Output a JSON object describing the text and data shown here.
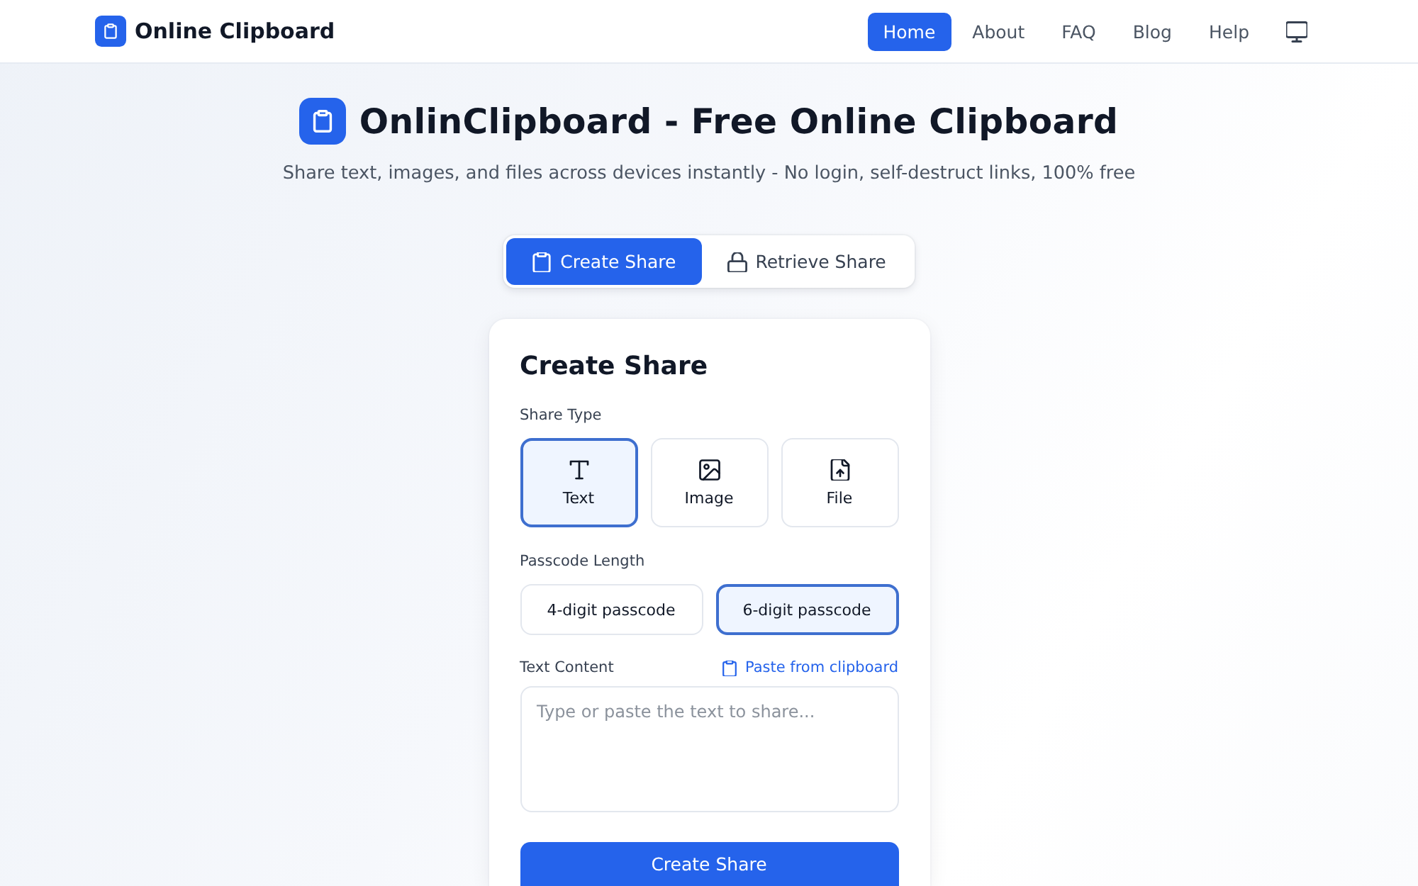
{
  "header": {
    "brand": "Online Clipboard",
    "nav": [
      {
        "label": "Home",
        "selected": true
      },
      {
        "label": "About",
        "selected": false
      },
      {
        "label": "FAQ",
        "selected": false
      },
      {
        "label": "Blog",
        "selected": false
      },
      {
        "label": "Help",
        "selected": false
      }
    ]
  },
  "hero": {
    "title": "OnlinClipboard - Free Online Clipboard",
    "subtitle": "Share text, images, and files across devices instantly - No login, self-destruct links, 100% free"
  },
  "mode_tabs": [
    {
      "label": "Create Share",
      "kind": "create",
      "selected": true
    },
    {
      "label": "Retrieve Share",
      "kind": "retrieve",
      "selected": false
    }
  ],
  "card": {
    "title": "Create Share",
    "share_type": {
      "label": "Share Type",
      "options": [
        {
          "label": "Text",
          "kind": "text",
          "selected": true
        },
        {
          "label": "Image",
          "kind": "image",
          "selected": false
        },
        {
          "label": "File",
          "kind": "file",
          "selected": false
        }
      ]
    },
    "passcode_length": {
      "label": "Passcode Length",
      "options": [
        {
          "label": "4-digit passcode",
          "selected": false
        },
        {
          "label": "6-digit passcode",
          "selected": true
        }
      ]
    },
    "text_content": {
      "label": "Text Content",
      "paste_link": "Paste from clipboard",
      "placeholder": "Type or paste the text to share..."
    },
    "submit": "Create Share"
  }
}
